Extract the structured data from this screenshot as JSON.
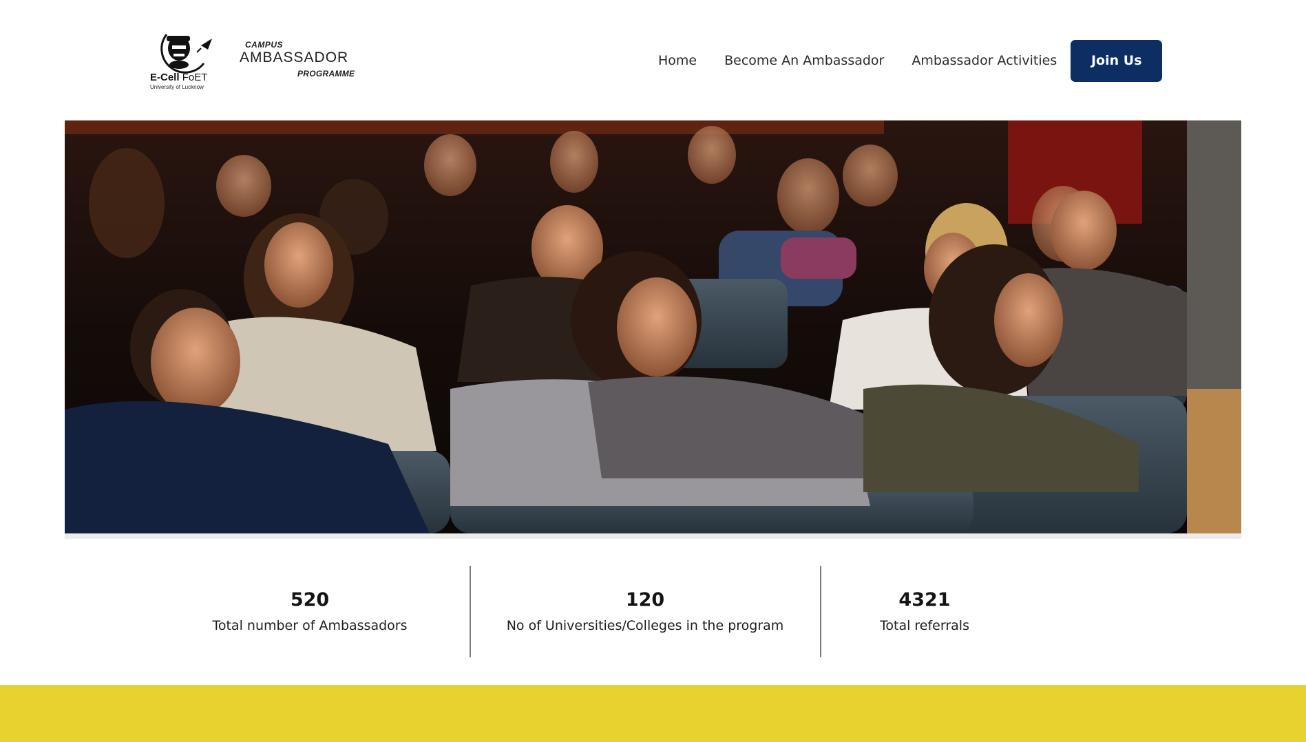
{
  "brand": {
    "logo_line1_bold": "E-Cell",
    "logo_line1_thin": "FoET",
    "logo_subtitle": "University of Lucknow",
    "program_top": "CAMPUS",
    "program_main": "Ambassador",
    "program_bottom": "PROGRAMME"
  },
  "nav": {
    "home": "Home",
    "become": "Become An Ambassador",
    "activities": "Ambassador Activities",
    "join": "Join Us"
  },
  "colors": {
    "primary_button": "#0c2e63",
    "accent_band": "#e8d22e",
    "divider": "#7a7a7a"
  },
  "hero": {
    "icon": "audience-photo"
  },
  "stats": [
    {
      "value": "520",
      "label": "Total number of Ambassadors"
    },
    {
      "value": "120",
      "label": "No of Universities/Colleges in the program"
    },
    {
      "value": "4321",
      "label": "Total referrals"
    }
  ]
}
